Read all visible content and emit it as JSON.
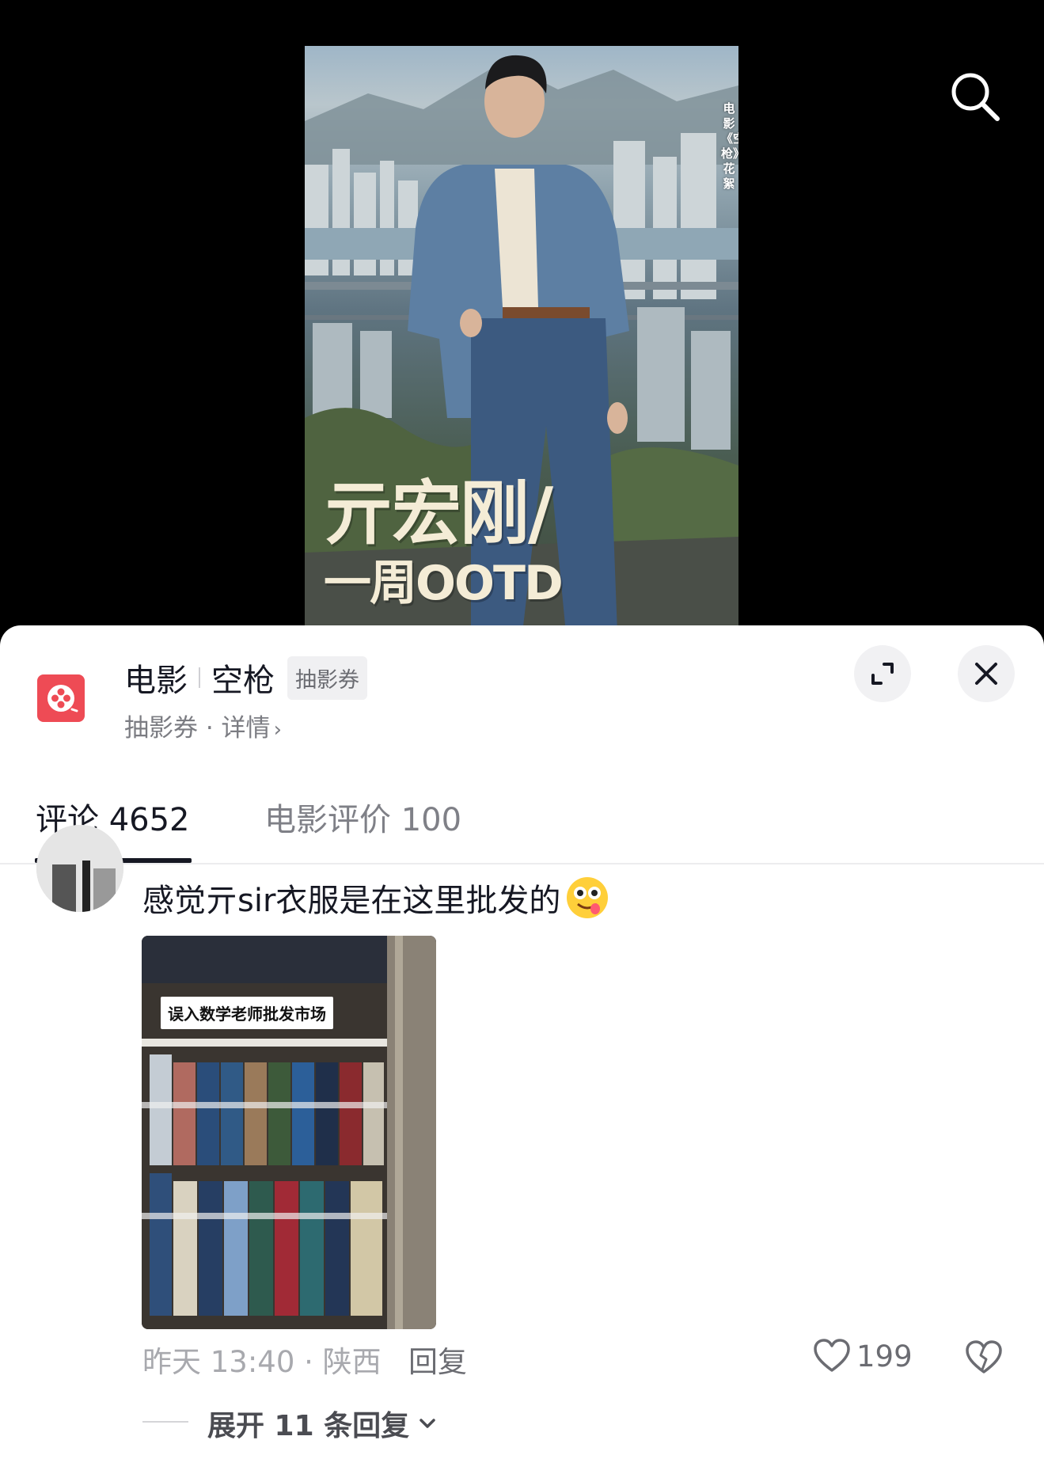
{
  "video": {
    "poster_side_text": "电影《空枪》花絮",
    "poster_title_line1": "亓宏刚/",
    "poster_title_line2": "一周OOTD"
  },
  "top_bar": {
    "search_icon": "search-icon"
  },
  "header": {
    "category": "电影",
    "title": "空枪",
    "badge": "抽影券",
    "subtitle": "抽影券 · 详情",
    "subtitle_chevron": "›",
    "expand_icon": "expand-icon",
    "close_icon": "close-icon"
  },
  "tabs": [
    {
      "label": "评论 4652",
      "active": true
    },
    {
      "label": "电影评价 100",
      "active": false
    }
  ],
  "comment": {
    "text": "感觉亓sir衣服是在这里批发的",
    "emoji": "drooling-face-emoji",
    "image_caption": "误入数学老师批发市场",
    "time_location": "昨天 13:40 · 陕西",
    "reply_label": "回复",
    "like_count": "199",
    "expand_label": "展开 11 条回复"
  },
  "colors": {
    "app_logo": "#ee4b55",
    "text_primary": "#161823",
    "text_secondary": "#7b7c82",
    "poster_title": "#f4ecd6"
  }
}
